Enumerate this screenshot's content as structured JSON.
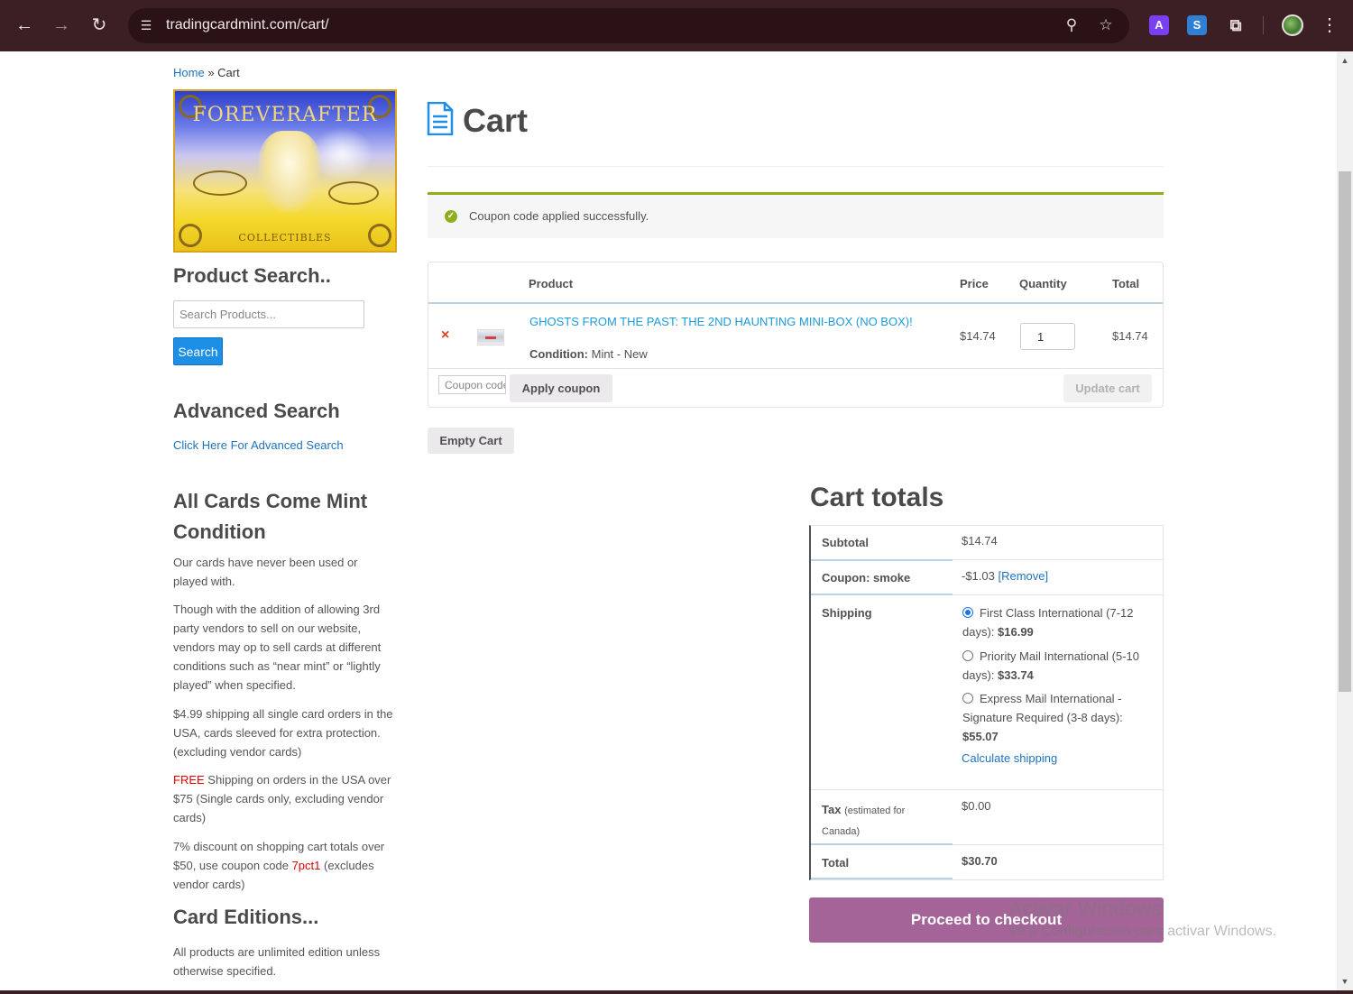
{
  "browser": {
    "url": "tradingcardmint.com/cart/",
    "icons": [
      "back-arrow-icon",
      "forward-arrow-icon",
      "reload-icon",
      "site-settings-icon",
      "zoom-icon",
      "bookmark-star-icon",
      "extension-a-icon",
      "extension-s-icon",
      "extensions-puzzle-icon",
      "profile-avatar-icon",
      "menu-kebab-icon"
    ],
    "ext_a_label": "A",
    "ext_s_label": "S"
  },
  "breadcrumb": {
    "home": "Home",
    "sep": "»",
    "current": "Cart"
  },
  "logo": {
    "title": "FOREVERAFTER",
    "subtitle": "COLLECTIBLES"
  },
  "sidebar": {
    "product_search_heading": "Product Search..",
    "search_placeholder": "Search Products...",
    "search_button": "Search",
    "advanced_heading": "Advanced Search",
    "advanced_link": "Click Here For Advanced Search",
    "mint_heading": "All Cards Come Mint Condition",
    "mint_p1": "Our cards have never been used or played with.",
    "mint_p2": "Though with the addition of allowing 3rd party vendors to sell on our website, vendors may op to sell cards at different conditions such as “near mint” or “lightly played” when specified.",
    "shipping_p": "$4.99 shipping all single card orders in the USA, cards sleeved for extra protection. (excluding vendor cards)",
    "free_word": "FREE",
    "free_rest": " Shipping on orders in the USA over $75 (Single cards only, excluding vendor cards)",
    "discount_pre": "7% discount on shopping cart totals over $50, use coupon code ",
    "discount_code": "7pct1",
    "discount_post": " (excludes vendor cards)",
    "editions_heading": "Card Editions...",
    "editions_p": "All products are unlimited edition unless otherwise specified."
  },
  "main": {
    "title": "Cart",
    "notice": "Coupon code applied successfully.",
    "table": {
      "headers": {
        "product": "Product",
        "price": "Price",
        "quantity": "Quantity",
        "total": "Total"
      },
      "items": [
        {
          "name": "GHOSTS FROM THE PAST: THE 2ND HAUNTING MINI-BOX (NO BOX)!",
          "condition_label": "Condition:",
          "condition_value": "Mint - New",
          "price": "$14.74",
          "quantity": "1",
          "total": "$14.74"
        }
      ],
      "remove_symbol": "×",
      "coupon_placeholder": "Coupon code",
      "apply_coupon": "Apply coupon",
      "update_cart": "Update cart"
    },
    "empty_cart": "Empty Cart"
  },
  "totals": {
    "heading": "Cart totals",
    "subtotal_label": "Subtotal",
    "subtotal_value": "$14.74",
    "coupon_label": "Coupon: smoke",
    "coupon_value": "-$1.03",
    "coupon_remove": "[Remove]",
    "shipping_label": "Shipping",
    "shipping_options": [
      {
        "text": "First Class International (7-12 days): ",
        "price": "$16.99",
        "selected": true
      },
      {
        "text": "Priority Mail International (5-10 days): ",
        "price": "$33.74",
        "selected": false
      },
      {
        "text": "Express Mail International - Signature Required (3-8 days): ",
        "price": "$55.07",
        "selected": false
      }
    ],
    "calculate_shipping": "Calculate shipping",
    "tax_label": "Tax",
    "tax_note": "(estimated for Canada)",
    "tax_value": "$0.00",
    "total_label": "Total",
    "total_value": "$30.70",
    "checkout_button": "Proceed to checkout"
  },
  "watermark": {
    "line1": "Activar Windows",
    "line2": "Ve a Configuración para activar Windows."
  },
  "colors": {
    "checkout": "#a46497",
    "link": "#1e73be",
    "notice_border": "#8fae1b",
    "browser_frame": "#3b1f24"
  }
}
